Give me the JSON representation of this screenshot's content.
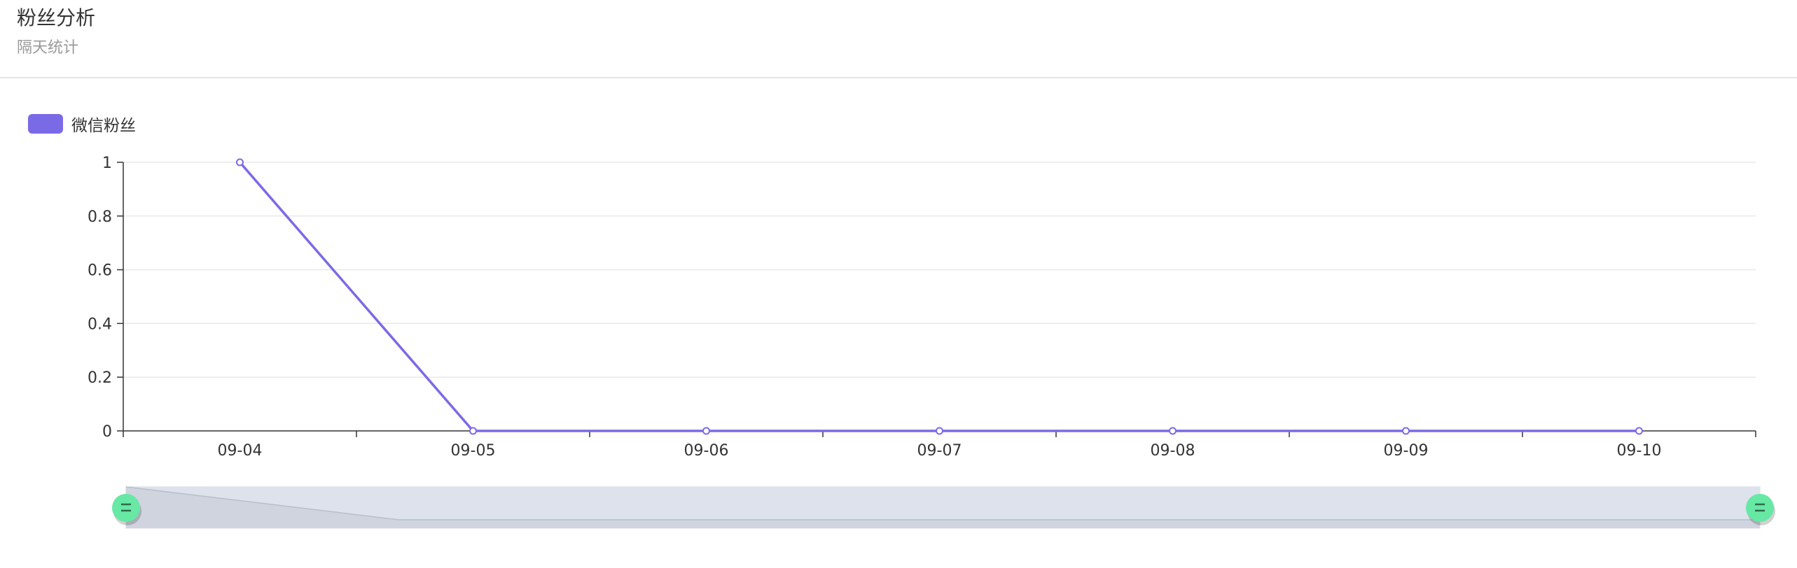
{
  "header": {
    "title": "粉丝分析",
    "subtitle": "隔天统计"
  },
  "colors": {
    "series": "#7b6ae6",
    "grid": "#e8e8e8",
    "axis": "#333333",
    "zoom_fill": "#dde2ec",
    "zoom_handle": "#67e8a4"
  },
  "chart_data": {
    "type": "line",
    "categories": [
      "09-04",
      "09-05",
      "09-06",
      "09-07",
      "09-08",
      "09-09",
      "09-10"
    ],
    "series": [
      {
        "name": "微信粉丝",
        "values": [
          1,
          0,
          0,
          0,
          0,
          0,
          0
        ]
      }
    ],
    "ylim": [
      0,
      1
    ],
    "yticks": [
      "0",
      "0.2",
      "0.4",
      "0.6",
      "0.8",
      "1"
    ],
    "grid": true,
    "legend": "top-left",
    "datazoom": {
      "start_percent": 0,
      "end_percent": 100
    }
  }
}
